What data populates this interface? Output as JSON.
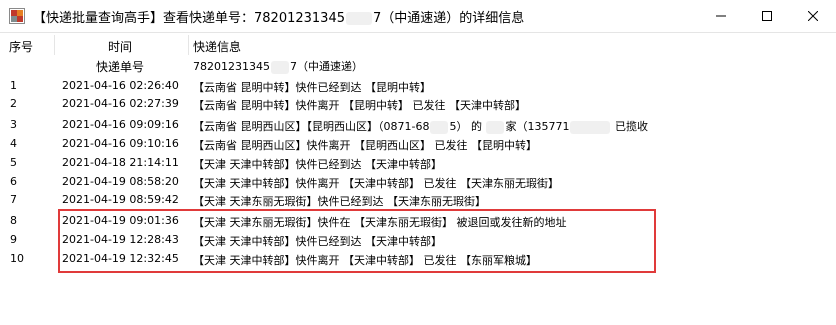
{
  "window": {
    "title_before": "【快递批量查询高手】查看快递单号：78201231345",
    "title_after": "7（中通速递）的详细信息"
  },
  "header": {
    "col_index": "序号",
    "col_time": "时间",
    "col_info": "快递信息",
    "sub_label": "快递单号",
    "tracking_before": "78201231345",
    "tracking_after": "7（中通速递）"
  },
  "rows": [
    {
      "index": "1",
      "time": "2021-04-16 02:26:40",
      "info": "【云南省 昆明中转】快件已经到达 【昆明中转】"
    },
    {
      "index": "2",
      "time": "2021-04-16 02:27:39",
      "info": "【云南省 昆明中转】快件离开 【昆明中转】 已发往 【天津中转部】"
    },
    {
      "index": "3",
      "time": "2021-04-16 09:09:16",
      "info_parts": [
        "【云南省 昆明西山区】【昆明西山区】（0871-68",
        "5） 的 ",
        "家（135771",
        " 已揽收"
      ]
    },
    {
      "index": "4",
      "time": "2021-04-16 09:10:16",
      "info": "【云南省 昆明西山区】快件离开 【昆明西山区】 已发往 【昆明中转】"
    },
    {
      "index": "5",
      "time": "2021-04-18 21:14:11",
      "info": "【天津 天津中转部】快件已经到达 【天津中转部】"
    },
    {
      "index": "6",
      "time": "2021-04-19 08:58:20",
      "info": "【天津 天津中转部】快件离开 【天津中转部】 已发往 【天津东丽无瑕街】"
    },
    {
      "index": "7",
      "time": "2021-04-19 08:59:42",
      "info": "【天津 天津东丽无瑕街】快件已经到达 【天津东丽无瑕街】"
    },
    {
      "index": "8",
      "time": "2021-04-19 09:01:36",
      "info": "【天津 天津东丽无瑕街】快件在 【天津东丽无瑕街】 被退回或发往新的地址"
    },
    {
      "index": "9",
      "time": "2021-04-19 12:28:43",
      "info": "【天津 天津中转部】快件已经到达 【天津中转部】"
    },
    {
      "index": "10",
      "time": "2021-04-19 12:32:45",
      "info": "【天津 天津中转部】快件离开 【天津中转部】 已发往 【东丽军粮城】"
    }
  ],
  "icons": {
    "app": "app-logo-icon",
    "minimize": "minimize-icon",
    "maximize": "maximize-icon",
    "close": "close-icon"
  },
  "colors": {
    "highlight_box": "#e03a3a"
  }
}
